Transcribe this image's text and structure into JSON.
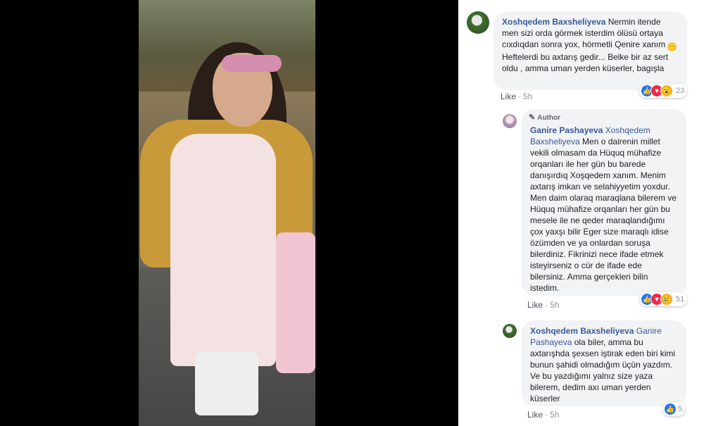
{
  "comments": [
    {
      "name": "Xoshqedem Baxsheliyeva",
      "text_before_emoji": " Nermin itende men sizi orda görmek isterdim ölüsü ortaya cıxdıqdan sonra yox, hörmetli Qenire xanım ",
      "emoji": "😶",
      "text_after_emoji": " Heftelerdi bu axtarış gedir... Belke bir az sert oldu , amma uman yerden küserler, bagışla",
      "like": "Like",
      "time": "5h",
      "reaction_count": "23",
      "reactions": [
        "like-reaction-icon",
        "love-reaction-icon",
        "wow-reaction-icon"
      ]
    },
    {
      "badge": "Author",
      "name": "Ganire Pashayeva",
      "mention": "Xoshqedem Baxsheliyeva",
      "text": " Men o dairenin millet vekili olmasam da Hüquq mühafize orqanları ile her gün bu barede danışırdıq Xoşqedem xanım. Menim axtarış imkan ve selahiyyetim yoxdur. Men daim olaraq maraqlana bilerem ve Hüquq mühafize orqanları her gün bu mesele ile ne qeder maraqlandığımı çox yaxşı bilir Eger size maraqlı idise özümden ve ya onlardan soruşa bilerdiniz. Fikrinizi nece ifade etmek isteyirseniz o cür de ifade ede bilersiniz. Amma gerçekleri bilin istedim.",
      "like": "Like",
      "time": "5h",
      "reaction_count": "51",
      "reactions": [
        "like-reaction-icon",
        "love-reaction-icon",
        "sad-reaction-icon"
      ]
    },
    {
      "name": "Xoshqedem Baxsheliyeva",
      "mention": "Ganire Pashayeva",
      "text": " ola biler, amma bu axtarışhda şexsen iştirak eden biri kimi bunun şahidi olmadığım üçün yazdım. Ve bu yazdığımı yalnız size yaza bilerem, dedim axı uman yerden küserler",
      "like": "Like",
      "time": "5h",
      "reaction_count": "5",
      "reactions": [
        "like-reaction-icon"
      ]
    }
  ],
  "colors": {
    "link": "#385898",
    "bubble": "#f2f3f5",
    "like_blue": "#2078f4"
  }
}
